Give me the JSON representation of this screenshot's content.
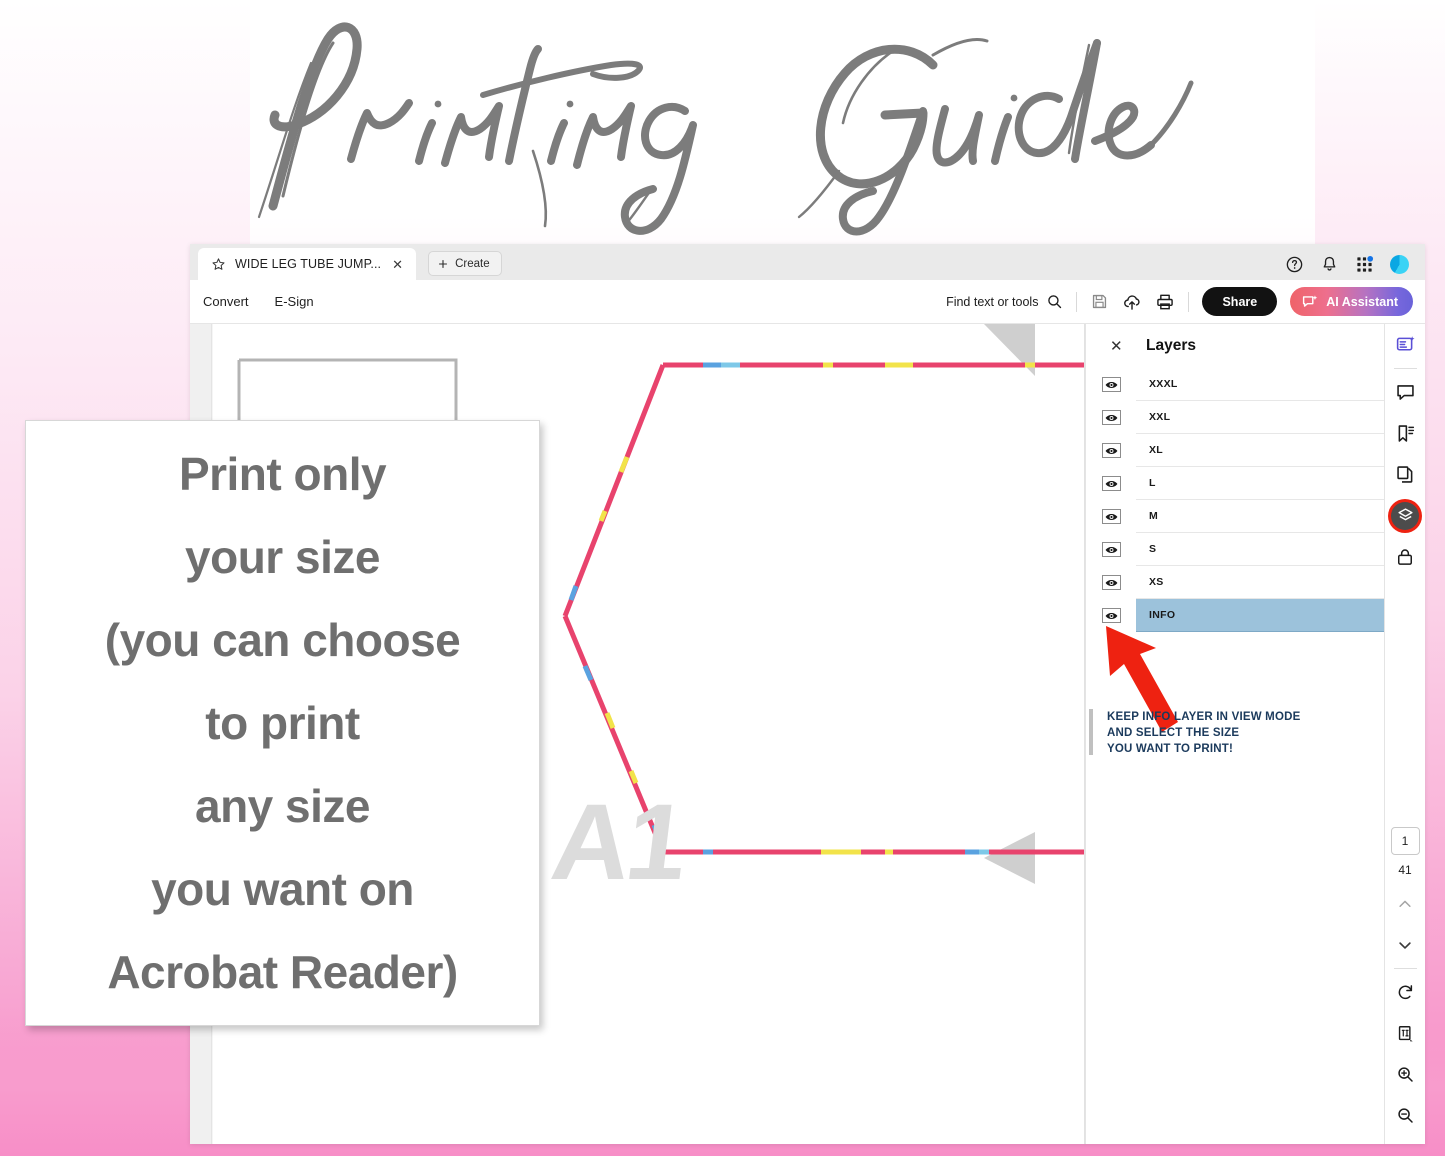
{
  "poster": {
    "title": "Printing Guide",
    "background_top": "#ffffff",
    "background_pink": "#f89ccd",
    "title_color": "#7a7a7a"
  },
  "overlay_card": {
    "lines": [
      "Print only",
      "your size",
      "(you can choose",
      "to print",
      "any size",
      "you want on",
      "Acrobat Reader)"
    ],
    "text_color": "#6f6f6f"
  },
  "app": {
    "tab": {
      "title": "WIDE LEG TUBE JUMP...",
      "star_icon": "star-icon",
      "close_icon": "close-icon"
    },
    "create_button": {
      "label": "Create",
      "icon": "plus-icon"
    },
    "header_icons": [
      {
        "name": "help-icon",
        "glyph": "?"
      },
      {
        "name": "notification-bell-icon",
        "glyph": "bell"
      },
      {
        "name": "app-grid-icon",
        "glyph": "grid",
        "badge_color": "#1473e6"
      },
      {
        "name": "avatar",
        "glyph": "avatar",
        "color": "#19b3ec"
      }
    ],
    "toolbar": {
      "menus": [
        "Convert",
        "E-Sign"
      ],
      "find_label": "Find text or tools",
      "find_icon": "search-icon",
      "save_icon": "save-icon",
      "cloud_upload_icon": "cloud-upload-icon",
      "print_icon": "print-icon",
      "share_label": "Share",
      "share_bg": "#121212",
      "ai_label": "AI Assistant",
      "ai_icon": "ai-sparkle-icon",
      "ai_gradient_from": "#ef6369",
      "ai_gradient_to": "#6a62d9"
    }
  },
  "layers_panel": {
    "title": "Layers",
    "close_icon": "close-icon",
    "more_icon": "more-options-icon",
    "eye_icon": "eye-visibility-icon",
    "selected_row_color": "#9cc2db",
    "items": [
      {
        "label": "XXXL",
        "visible": true,
        "selected": false
      },
      {
        "label": "XXL",
        "visible": true,
        "selected": false
      },
      {
        "label": "XL",
        "visible": true,
        "selected": false
      },
      {
        "label": "L",
        "visible": true,
        "selected": false
      },
      {
        "label": "M",
        "visible": true,
        "selected": false
      },
      {
        "label": "S",
        "visible": true,
        "selected": false
      },
      {
        "label": "XS",
        "visible": true,
        "selected": false
      },
      {
        "label": "INFO",
        "visible": true,
        "selected": true
      }
    ],
    "annotation": {
      "line1": "KEEP INFO LAYER IN VIEW MODE",
      "line2": "AND SELECT THE SIZE",
      "line3": "YOU WANT TO PRINT!",
      "color": "#1b3a5c",
      "arrow_color": "#ee2211",
      "arrow_icon": "red-arrow-pointer-icon"
    }
  },
  "right_rail": {
    "icons": [
      {
        "name": "ai-assistant-rail-icon",
        "active": false
      },
      {
        "name": "comment-icon",
        "active": false
      },
      {
        "name": "bookmark-icon",
        "active": false
      },
      {
        "name": "organize-pages-icon",
        "active": false
      },
      {
        "name": "layers-icon",
        "active": true,
        "highlight_ring": "#ee2211"
      },
      {
        "name": "protect-lock-icon",
        "active": false
      }
    ],
    "page_number": "1",
    "page_total": "41",
    "prev_icon": "chevron-up-icon",
    "next_icon": "chevron-down-icon",
    "rotate_icon": "rotate-icon",
    "fit-page_icon": "fit-page-icon",
    "zoom_in_icon": "zoom-in-icon",
    "zoom_out_icon": "zoom-out-icon"
  },
  "document": {
    "watermark": "A1",
    "watermark_color": "#dcdcdc",
    "pattern_outline_color": "#e8436d",
    "pattern_marker_colors": [
      "#f2e34a",
      "#5aa2e0",
      "#7ec8e8"
    ],
    "grey_box_color": "#b4b4b4",
    "corner_triangle_color": "#cfcfcf"
  }
}
